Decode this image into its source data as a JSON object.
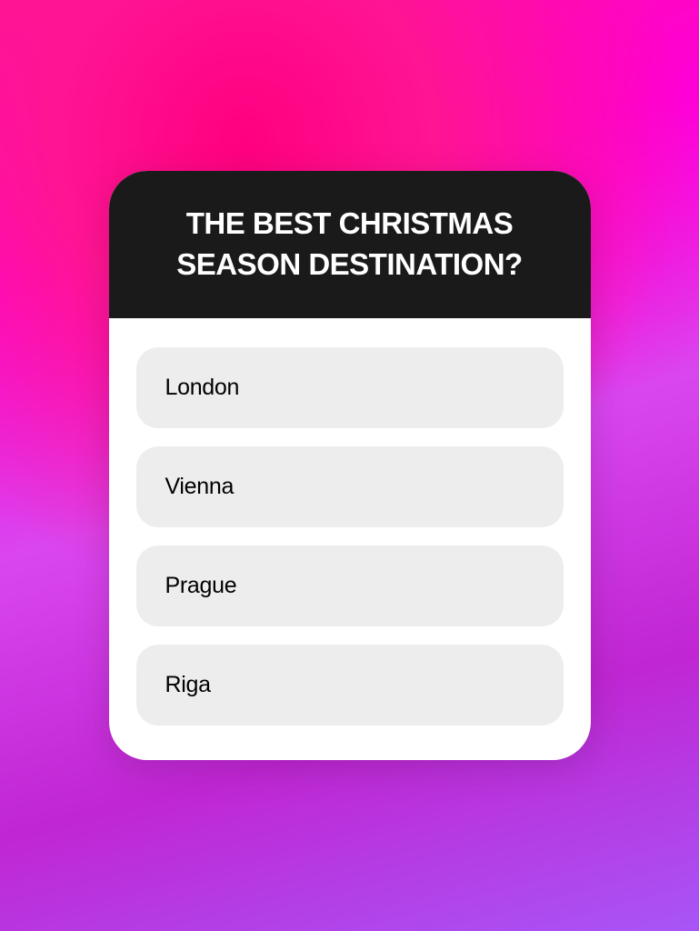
{
  "quiz": {
    "question": "THE BEST CHRISTMAS SEASON DESTINATION?",
    "options": [
      {
        "label": "London"
      },
      {
        "label": "Vienna"
      },
      {
        "label": "Prague"
      },
      {
        "label": "Riga"
      }
    ]
  }
}
